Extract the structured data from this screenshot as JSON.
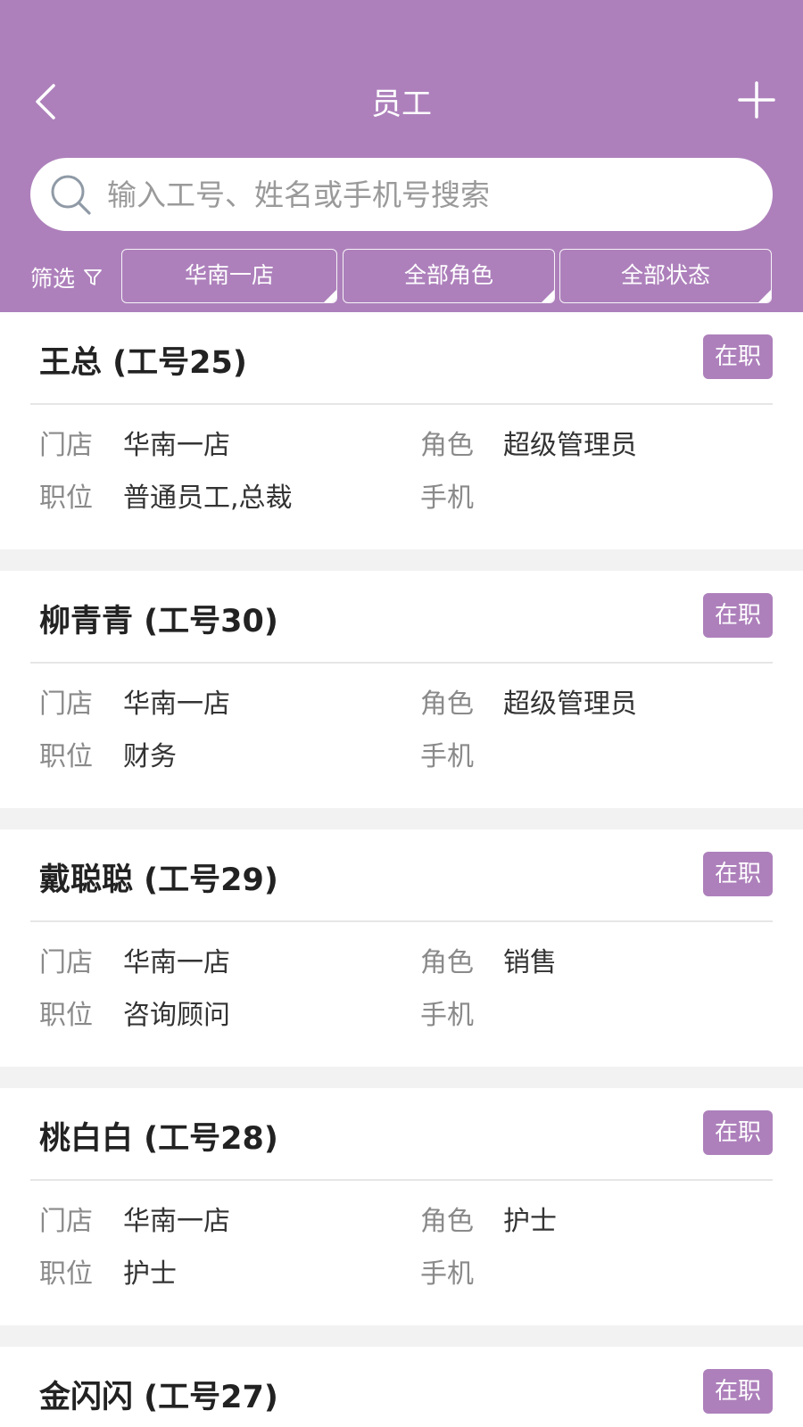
{
  "header": {
    "title": "员工",
    "back_icon": "chevron-left-icon",
    "add_icon": "plus-icon",
    "background_color": "#ad80bb"
  },
  "search": {
    "placeholder": "输入工号、姓名或手机号搜索",
    "value": "",
    "icon": "search-icon"
  },
  "filters": {
    "label": "筛选",
    "icon": "filter-icon",
    "store": "华南一店",
    "role": "全部角色",
    "status": "全部状态"
  },
  "field_labels": {
    "store": "门店",
    "role": "角色",
    "position": "职位",
    "phone": "手机"
  },
  "employees": [
    {
      "name": "王总 (工号25)",
      "status": "在职",
      "store": "华南一店",
      "role": "超级管理员",
      "position": "普通员工,总裁",
      "phone": ""
    },
    {
      "name": "柳青青 (工号30)",
      "status": "在职",
      "store": "华南一店",
      "role": "超级管理员",
      "position": "财务",
      "phone": ""
    },
    {
      "name": "戴聪聪 (工号29)",
      "status": "在职",
      "store": "华南一店",
      "role": "销售",
      "position": "咨询顾问",
      "phone": ""
    },
    {
      "name": "桃白白 (工号28)",
      "status": "在职",
      "store": "华南一店",
      "role": "护士",
      "position": "护士",
      "phone": ""
    },
    {
      "name": "金闪闪 (工号27)",
      "status": "在职",
      "store": "",
      "role": "",
      "position": "",
      "phone": ""
    }
  ]
}
